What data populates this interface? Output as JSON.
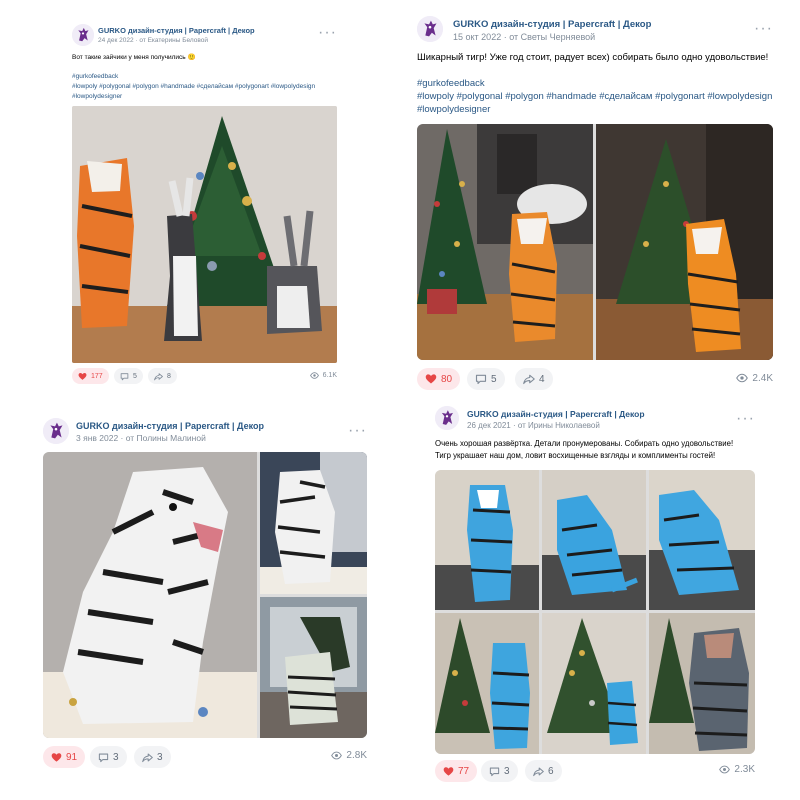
{
  "colors": {
    "link": "#2a5885",
    "meta": "#818c99",
    "like": "#e64646"
  },
  "icons": {
    "like": "heart-icon",
    "comment": "comment-icon",
    "share": "share-icon",
    "views": "eye-icon",
    "menu": "more-icon"
  },
  "posts": [
    {
      "author": "GURKO дизайн-студия | Papercraft | Декор",
      "date": "24 дек 2022",
      "from": "от Екатерины Беловой",
      "text": "Вот такие зайчики у меня получились 🙂",
      "tags": "#gurkofeedback\n#lowpoly #polygonal #polygon #handmade #сделайсам #polygonart #lowpolydesign\n#lowpolydesigner",
      "likes": "177",
      "comments": "5",
      "shares": "8",
      "views": "6.1K"
    },
    {
      "author": "GURKO дизайн-студия | Papercraft | Декор",
      "date": "15 окт 2022",
      "from": "от Светы Черняевой",
      "text": "Шикарный тигр! Уже год стоит, радует всех) собирать было одно удовольствие!",
      "tags": "#gurkofeedback\n#lowpoly #polygonal #polygon #handmade #сделайсам #polygonart #lowpolydesign\n#lowpolydesigner",
      "likes": "80",
      "comments": "5",
      "shares": "4",
      "views": "2.4K"
    },
    {
      "author": "GURKO дизайн-студия | Papercraft | Декор",
      "date": "3 янв 2022",
      "from": "от Полины Малиной",
      "text": "",
      "tags": "",
      "likes": "91",
      "comments": "3",
      "shares": "3",
      "views": "2.8K"
    },
    {
      "author": "GURKO дизайн-студия | Papercraft | Декор",
      "date": "26 дек 2021",
      "from": "от Ирины Николаевой",
      "text": "Очень хорошая развёртка. Детали пронумерованы. Собирать одно удовольствие!\nТигр украшает наш дом, ловит восхищенные взгляды и комплименты гостей!",
      "tags": "",
      "likes": "77",
      "comments": "3",
      "shares": "6",
      "views": "2.3K"
    }
  ]
}
